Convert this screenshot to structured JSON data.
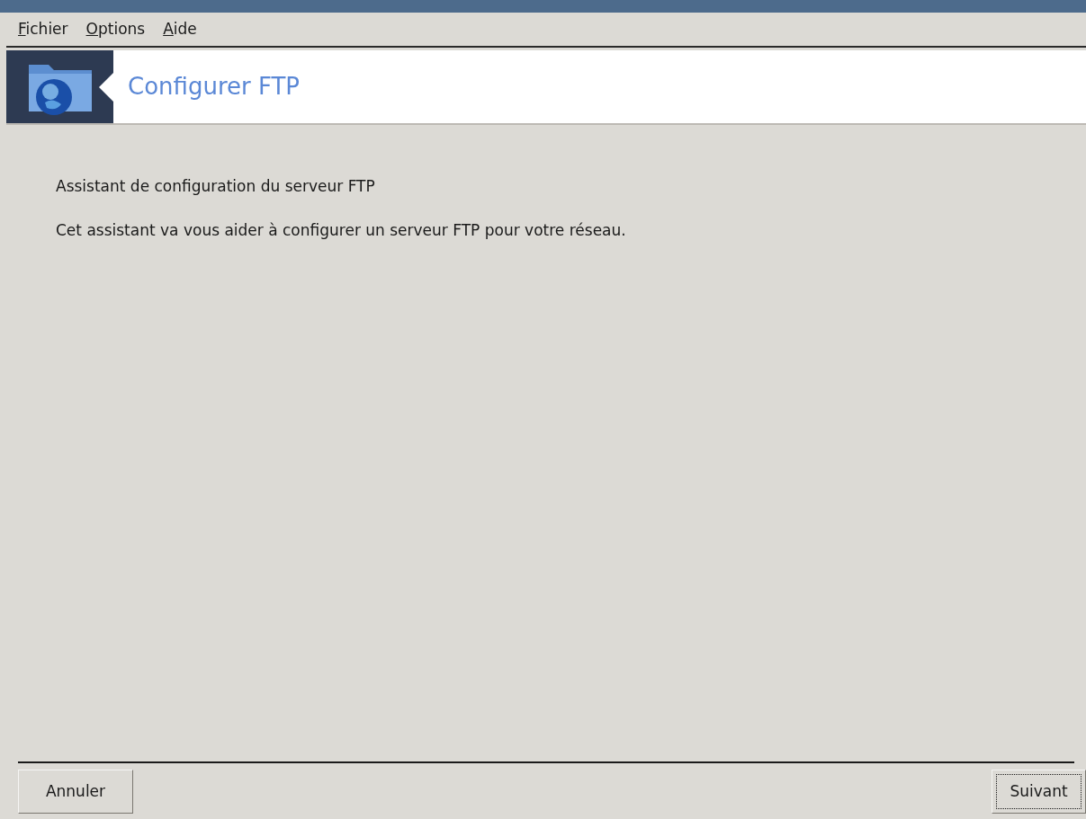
{
  "menu_bar": [
    {
      "label": "Fichier"
    },
    {
      "label": "Options"
    },
    {
      "label": "Aide"
    }
  ],
  "header": {
    "title": "Configurer FTP"
  },
  "content": {
    "heading": "Assistant de configuration du serveur FTP",
    "description": "Cet assistant va vous aider à configurer un serveur FTP pour votre réseau."
  },
  "buttons": [
    {
      "label": "Annuler",
      "focused": false
    },
    {
      "label": "Suivant",
      "focused": true
    }
  ]
}
